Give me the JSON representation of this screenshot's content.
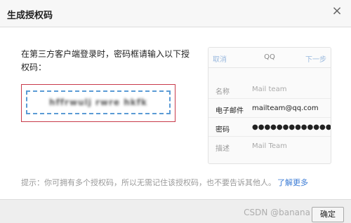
{
  "dialog": {
    "title": "生成授权码",
    "close_glyph": "×"
  },
  "instruction": "在第三方客户端登录时，密码框请输入以下授权码：",
  "auth_code": "hffrwulj rwre hkfk",
  "phone_preview": {
    "cancel": "取消",
    "title": "QQ",
    "next": "下一步",
    "rows": [
      {
        "label": "名称",
        "value": "Mail team"
      },
      {
        "label": "电子邮件",
        "value": "mailteam@qq.com"
      },
      {
        "label": "密码",
        "value": "●●●●●●●●●●●●●●●●"
      },
      {
        "label": "描述",
        "value": "Mail Team"
      }
    ]
  },
  "hint": {
    "text": "提示：你可拥有多个授权码，所以无需记住该授权码，也不要告诉其他人。",
    "link": "了解更多"
  },
  "footer": {
    "confirm": "确定",
    "watermark": "CSDN @banana"
  },
  "colors": {
    "highlight_border": "#c83a4a",
    "dashed_border": "#5b9bd5",
    "link": "#3a7bd5"
  }
}
